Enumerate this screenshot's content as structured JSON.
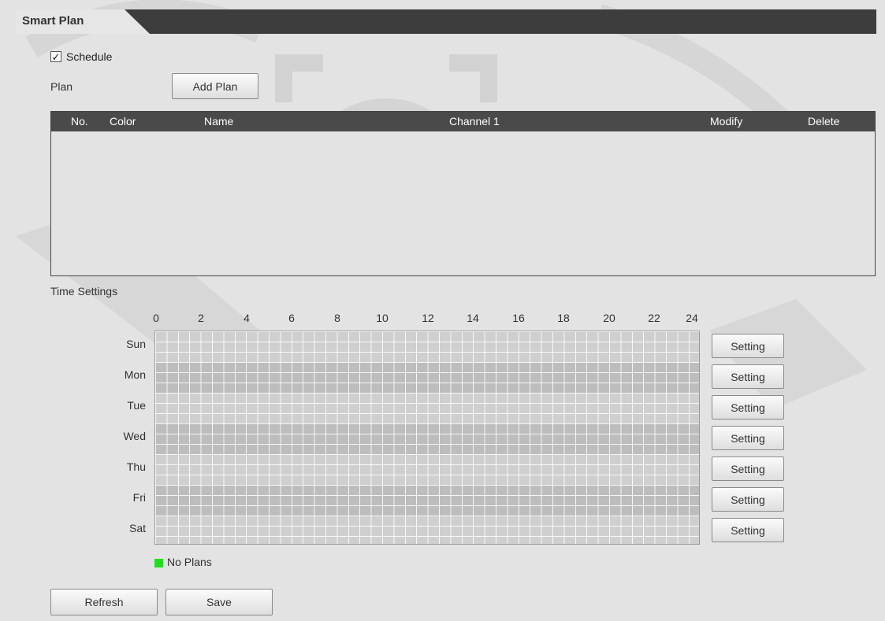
{
  "tab": {
    "label": "Smart Plan"
  },
  "schedule": {
    "checked": true,
    "check_glyph": "✓",
    "label": "Schedule"
  },
  "plan": {
    "label": "Plan",
    "add_button": "Add Plan"
  },
  "table": {
    "headers": [
      "No.",
      "Color",
      "Name",
      "Channel 1",
      "Modify",
      "Delete"
    ],
    "rows": []
  },
  "time_settings": {
    "label": "Time Settings",
    "hours": [
      "0",
      "2",
      "4",
      "6",
      "8",
      "10",
      "12",
      "14",
      "16",
      "18",
      "20",
      "22",
      "24"
    ],
    "days": [
      "Sun",
      "Mon",
      "Tue",
      "Wed",
      "Thu",
      "Fri",
      "Sat"
    ],
    "setting_button": "Setting"
  },
  "legend": {
    "color": "#22dd22",
    "label": "No Plans"
  },
  "footer": {
    "refresh": "Refresh",
    "save": "Save"
  }
}
